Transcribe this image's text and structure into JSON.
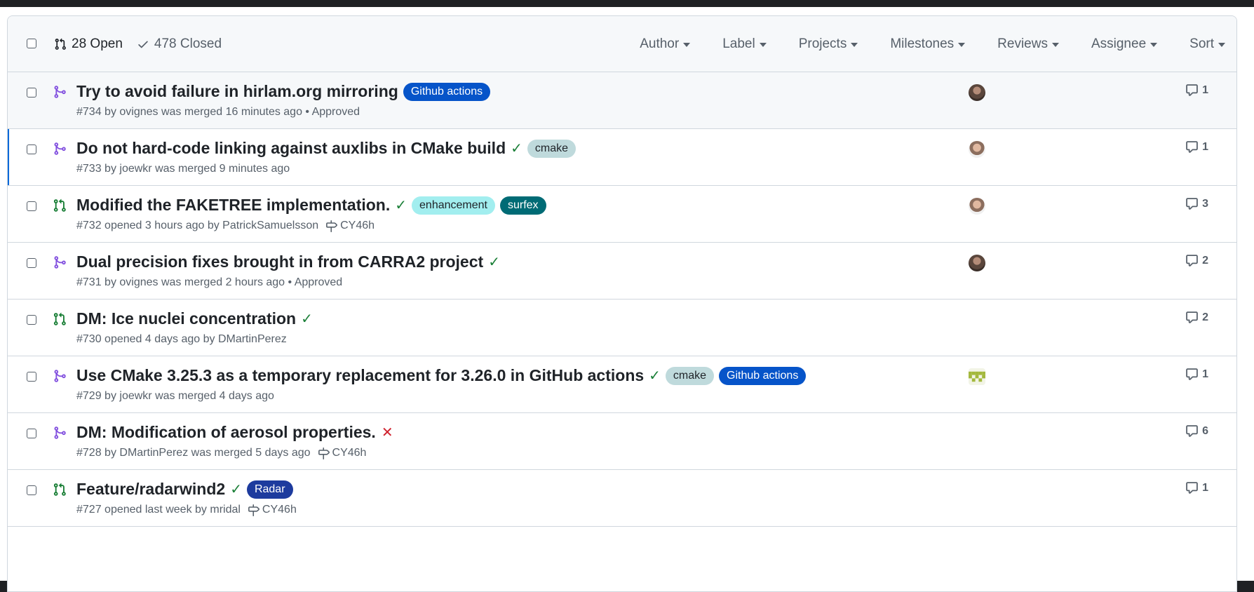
{
  "colors": {
    "merged": "#8250df",
    "open": "#1a7f37",
    "link_blue": "#0969da"
  },
  "header": {
    "open_label": "28 Open",
    "closed_label": "478 Closed",
    "filters": [
      "Author",
      "Label",
      "Projects",
      "Milestones",
      "Reviews",
      "Assignee",
      "Sort"
    ]
  },
  "pulls": [
    {
      "status": "merged",
      "title": "Try to avoid failure in hirlam.org mirroring",
      "check": "",
      "labels": [
        {
          "name": "Github actions",
          "bg": "#0654c9",
          "fg": "#ffffff"
        }
      ],
      "meta": "#734 by ovignes was merged 16 minutes ago • Approved",
      "milestone": "",
      "avatar": "dark",
      "comments": "1",
      "hover": true,
      "selected": false
    },
    {
      "status": "merged",
      "title": "Do not hard-code linking against auxlibs in CMake build",
      "check": "success",
      "labels": [
        {
          "name": "cmake",
          "bg": "#bfdadc",
          "fg": "#1f2328"
        }
      ],
      "meta": "#733 by joewkr was merged 9 minutes ago",
      "milestone": "",
      "avatar": "light",
      "comments": "1",
      "hover": false,
      "selected": true
    },
    {
      "status": "open",
      "title": "Modified the FAKETREE implementation.",
      "check": "success",
      "labels": [
        {
          "name": "enhancement",
          "bg": "#a2eeef",
          "fg": "#1f2328"
        },
        {
          "name": "surfex",
          "bg": "#006b75",
          "fg": "#ffffff"
        }
      ],
      "meta": "#732 opened 3 hours ago by PatrickSamuelsson",
      "milestone": "CY46h",
      "avatar": "light",
      "comments": "3",
      "hover": false,
      "selected": false
    },
    {
      "status": "merged",
      "title": "Dual precision fixes brought in from CARRA2 project",
      "check": "success",
      "labels": [],
      "meta": "#731 by ovignes was merged 2 hours ago • Approved",
      "milestone": "",
      "avatar": "dark",
      "comments": "2",
      "hover": false,
      "selected": false
    },
    {
      "status": "open",
      "title": "DM: Ice nuclei concentration",
      "check": "success",
      "labels": [],
      "meta": "#730 opened 4 days ago by DMartinPerez",
      "milestone": "",
      "avatar": "",
      "comments": "2",
      "hover": false,
      "selected": false
    },
    {
      "status": "merged",
      "title": "Use CMake 3.25.3 as a temporary replacement for 3.26.0 in GitHub actions",
      "check": "success",
      "labels": [
        {
          "name": "cmake",
          "bg": "#bfdadc",
          "fg": "#1f2328"
        },
        {
          "name": "Github actions",
          "bg": "#0654c9",
          "fg": "#ffffff"
        }
      ],
      "meta": "#729 by joewkr was merged 4 days ago",
      "milestone": "",
      "avatar": "identicon",
      "comments": "1",
      "hover": false,
      "selected": false
    },
    {
      "status": "merged",
      "title": "DM: Modification of aerosol properties.",
      "check": "failure",
      "labels": [],
      "meta": "#728 by DMartinPerez was merged 5 days ago",
      "milestone": "CY46h",
      "avatar": "",
      "comments": "6",
      "hover": false,
      "selected": false
    },
    {
      "status": "open",
      "title": "Feature/radarwind2",
      "check": "success",
      "labels": [
        {
          "name": "Radar",
          "bg": "#1d3b9e",
          "fg": "#ffffff"
        }
      ],
      "meta": "#727 opened last week by mridal",
      "milestone": "CY46h",
      "avatar": "",
      "comments": "1",
      "hover": false,
      "selected": false
    }
  ]
}
